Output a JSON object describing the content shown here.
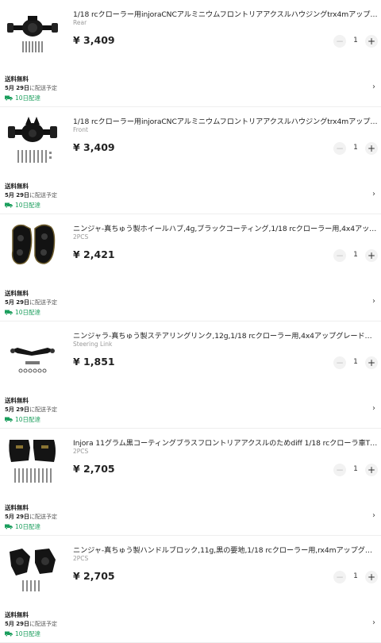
{
  "currency": "¥",
  "items": [
    {
      "title": "1/18 rcクローラー用injoraCNCアルミニウムフロントリアアクスルハウジングtrx4mアップグ…",
      "variant": "Rear",
      "price": "3,409",
      "qty": "1",
      "shipping": "送料無料",
      "date_day": "5月 29日",
      "date_suffix": "に配送予定",
      "delivery": "10日配達",
      "image": "rear-axle-housing"
    },
    {
      "title": "1/18 rcクローラー用injoraCNCアルミニウムフロントリアアクスルハウジングtrx4mアップグ…",
      "variant": "Front",
      "price": "3,409",
      "qty": "1",
      "shipping": "送料無料",
      "date_day": "5月 29日",
      "date_suffix": "に配送予定",
      "delivery": "10日配達",
      "image": "front-axle-housing"
    },
    {
      "title": "ニンジャ-真ちゅう製ホイールハブ,4g,ブラックコーティング,1/18 rcクローラー用,4x4アップ…",
      "variant": "2PCS",
      "price": "2,421",
      "qty": "1",
      "shipping": "送料無料",
      "date_day": "5月 29日",
      "date_suffix": "に配送予定",
      "delivery": "10日配達",
      "image": "wheel-hub"
    },
    {
      "title": "ニンジャラ-真ちゅう製ステアリングリンク,12g,1/18 rcクローラー用,4x4アップグレードパー…",
      "variant": "Steering Link",
      "price": "1,851",
      "qty": "1",
      "shipping": "送料無料",
      "date_day": "5月 29日",
      "date_suffix": "に配送予定",
      "delivery": "10日配達",
      "image": "steering-link"
    },
    {
      "title": "Injora 11グラム黒コーティングブラスフロントリアアクスルのためdiff 1/18 rcクローラ車TRX…",
      "variant": "2PCS",
      "price": "2,705",
      "qty": "1",
      "shipping": "送料無料",
      "date_day": "5月 29日",
      "date_suffix": "に配送予定",
      "delivery": "10日配達",
      "image": "diff-cover"
    },
    {
      "title": "ニンジャ-真ちゅう製ハンドルブロック,11g,黒の要地,1/18 rcクローラー用,rx4mアップグレー…",
      "variant": "2PCS",
      "price": "2,705",
      "qty": "1",
      "shipping": "送料無料",
      "date_day": "5月 29日",
      "date_suffix": "に配送予定",
      "delivery": "10日配達",
      "image": "steering-knuckle"
    }
  ],
  "colors": {
    "delivery_green": "#1a9e5c",
    "button_bg": "#f2f2f2",
    "divider": "#eeeeee"
  }
}
